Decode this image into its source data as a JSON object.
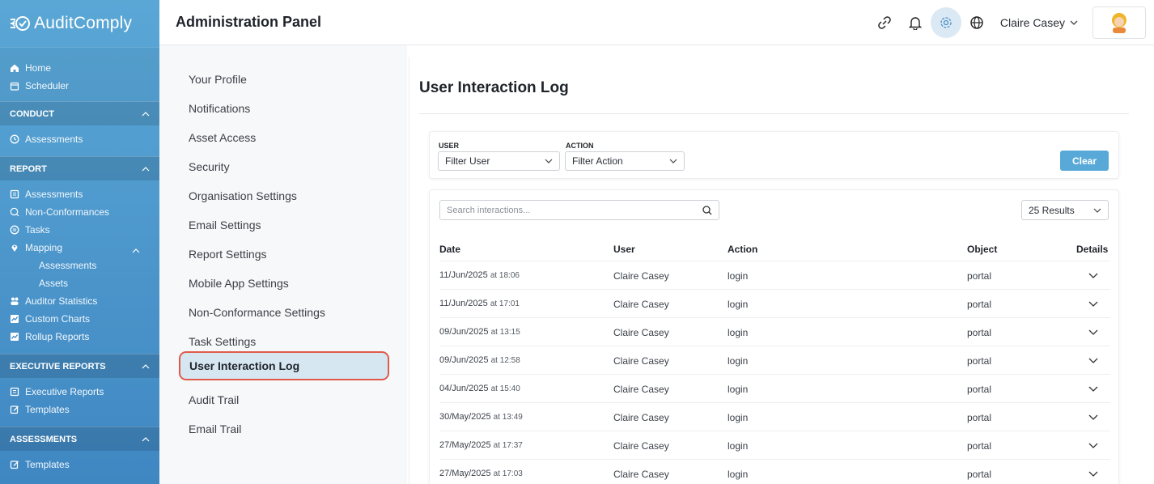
{
  "brand": {
    "name": "AuditComply"
  },
  "sidebar": {
    "top": [
      {
        "label": "Home",
        "icon": "home-icon"
      },
      {
        "label": "Scheduler",
        "icon": "calendar-icon"
      }
    ],
    "sections": [
      {
        "title": "CONDUCT",
        "items": [
          {
            "label": "Assessments",
            "icon": "clock-icon"
          }
        ]
      },
      {
        "title": "REPORT",
        "items": [
          {
            "label": "Assessments",
            "icon": "report-icon"
          },
          {
            "label": "Non-Conformances",
            "icon": "search-icon"
          },
          {
            "label": "Tasks",
            "icon": "tasks-icon"
          },
          {
            "label": "Mapping",
            "icon": "pin-icon"
          },
          {
            "label": "Assessments",
            "sub": true
          },
          {
            "label": "Assets",
            "sub": true
          },
          {
            "label": "Auditor Statistics",
            "icon": "users-icon"
          },
          {
            "label": "Custom Charts",
            "icon": "chart-icon"
          },
          {
            "label": "Rollup Reports",
            "icon": "chart-icon"
          }
        ]
      },
      {
        "title": "EXECUTIVE REPORTS",
        "items": [
          {
            "label": "Executive Reports",
            "icon": "report-icon"
          },
          {
            "label": "Templates",
            "icon": "edit-icon"
          }
        ]
      },
      {
        "title": "ASSESSMENTS",
        "items": [
          {
            "label": "Templates",
            "icon": "edit-icon"
          }
        ]
      }
    ]
  },
  "header": {
    "title": "Administration Panel",
    "user": "Claire Casey"
  },
  "settings_nav": [
    "Your Profile",
    "Notifications",
    "Asset Access",
    "Security",
    "Organisation Settings",
    "Email Settings",
    "Report Settings",
    "Mobile App Settings",
    "Non-Conformance Settings",
    "Task Settings",
    "User Interaction Log",
    "Audit Trail",
    "Email Trail"
  ],
  "main": {
    "title": "User Interaction Log",
    "filters": {
      "user_label": "USER",
      "user_value": "Filter User",
      "action_label": "ACTION",
      "action_value": "Filter Action",
      "clear": "Clear"
    },
    "search_placeholder": "Search interactions...",
    "results_select": "25 Results",
    "columns": [
      "Date",
      "User",
      "Action",
      "Object",
      "Details"
    ],
    "rows": [
      {
        "date": "11/Jun/2025",
        "time": "at 18:06",
        "user": "Claire Casey",
        "action": "login",
        "object": "portal"
      },
      {
        "date": "11/Jun/2025",
        "time": "at 17:01",
        "user": "Claire Casey",
        "action": "login",
        "object": "portal"
      },
      {
        "date": "09/Jun/2025",
        "time": "at 13:15",
        "user": "Claire Casey",
        "action": "login",
        "object": "portal"
      },
      {
        "date": "09/Jun/2025",
        "time": "at 12:58",
        "user": "Claire Casey",
        "action": "login",
        "object": "portal"
      },
      {
        "date": "04/Jun/2025",
        "time": "at 15:40",
        "user": "Claire Casey",
        "action": "login",
        "object": "portal"
      },
      {
        "date": "30/May/2025",
        "time": "at 13:49",
        "user": "Claire Casey",
        "action": "login",
        "object": "portal"
      },
      {
        "date": "27/May/2025",
        "time": "at 17:37",
        "user": "Claire Casey",
        "action": "login",
        "object": "portal"
      },
      {
        "date": "27/May/2025",
        "time": "at 17:03",
        "user": "Claire Casey",
        "action": "login",
        "object": "portal"
      }
    ]
  },
  "colors": {
    "sidebar_top": "#5aa7d6",
    "sidebar_bottom": "#3f87c2",
    "accent": "#58a9d8",
    "highlight_border": "#e05a4a"
  }
}
